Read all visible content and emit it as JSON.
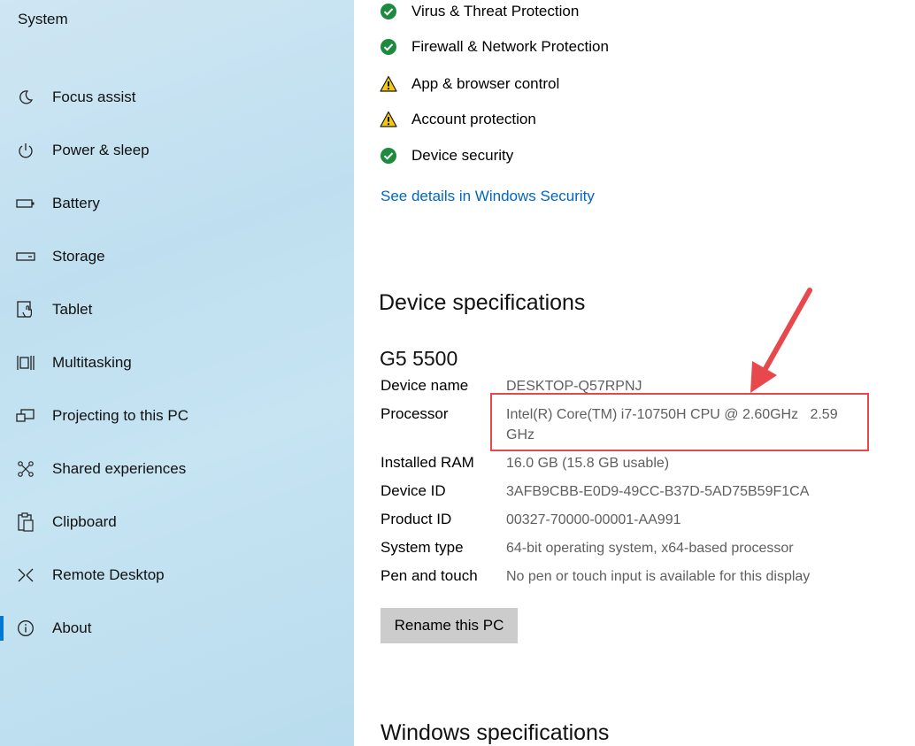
{
  "sidebar": {
    "title": "System",
    "items": [
      {
        "label": "Focus assist",
        "icon": "moon-icon"
      },
      {
        "label": "Power & sleep",
        "icon": "power-icon"
      },
      {
        "label": "Battery",
        "icon": "battery-icon"
      },
      {
        "label": "Storage",
        "icon": "storage-icon"
      },
      {
        "label": "Tablet",
        "icon": "tablet-icon"
      },
      {
        "label": "Multitasking",
        "icon": "multitasking-icon"
      },
      {
        "label": "Projecting to this PC",
        "icon": "projecting-icon"
      },
      {
        "label": "Shared experiences",
        "icon": "shared-experiences-icon"
      },
      {
        "label": "Clipboard",
        "icon": "clipboard-icon"
      },
      {
        "label": "Remote Desktop",
        "icon": "remote-desktop-icon"
      },
      {
        "label": "About",
        "icon": "info-icon",
        "selected": true
      }
    ]
  },
  "security": {
    "items": [
      {
        "label": "Virus & Threat Protection",
        "status": "ok"
      },
      {
        "label": "Firewall & Network Protection",
        "status": "ok"
      },
      {
        "label": "App & browser control",
        "status": "warning"
      },
      {
        "label": "Account protection",
        "status": "warning"
      },
      {
        "label": "Device security",
        "status": "ok"
      }
    ],
    "link": "See details in Windows Security"
  },
  "device_specs": {
    "heading": "Device specifications",
    "device_model": "G5 5500",
    "rows": [
      {
        "label": "Device name",
        "value": "DESKTOP-Q57RPNJ"
      },
      {
        "label": "Processor",
        "value": "Intel(R) Core(TM) i7-10750H CPU @ 2.60GHz   2.59 GHz"
      },
      {
        "label": "Installed RAM",
        "value": "16.0 GB (15.8 GB usable)"
      },
      {
        "label": "Device ID",
        "value": "3AFB9CBB-E0D9-49CC-B37D-5AD75B59F1CA"
      },
      {
        "label": "Product ID",
        "value": "00327-70000-00001-AA991"
      },
      {
        "label": "System type",
        "value": "64-bit operating system, x64-based processor"
      },
      {
        "label": "Pen and touch",
        "value": "No pen or touch input is available for this display"
      }
    ],
    "rename_button": "Rename this PC"
  },
  "windows_specs": {
    "heading": "Windows specifications"
  },
  "colors": {
    "ok": "#1e8a3e",
    "warning": "#f2c811",
    "link": "#0067c0",
    "accent": "#0078d4",
    "annotation": "#e8474c"
  }
}
